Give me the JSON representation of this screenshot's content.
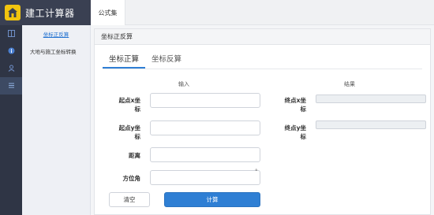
{
  "app": {
    "title": "建工计算器",
    "logo_icon": "house-icon"
  },
  "topbar": {
    "tab_label": "公式集"
  },
  "rail": {
    "icons": [
      "grid-icon",
      "info-icon",
      "user-icon",
      "list-icon"
    ],
    "active_index": 3
  },
  "menu": {
    "items": [
      {
        "label": "坐标正反算",
        "active": true
      },
      {
        "label": "大地与施工坐标转换",
        "active": false
      }
    ]
  },
  "panel": {
    "title": "坐标正反算",
    "tabs": [
      {
        "label": "坐标正算",
        "active": true
      },
      {
        "label": "坐标反算",
        "active": false
      }
    ],
    "input_title": "输入",
    "result_title": "结果",
    "inputs": {
      "start_x": {
        "label_line1": "起点x坐",
        "label_line2": "标",
        "value": ""
      },
      "start_y": {
        "label_line1": "起点y坐",
        "label_line2": "标",
        "value": ""
      },
      "distance": {
        "label": "距离",
        "value": ""
      },
      "azimuth": {
        "label": "方位角",
        "value": "",
        "unit": "°"
      }
    },
    "results": {
      "end_x": {
        "label_line1": "终点x坐",
        "label_line2": "标",
        "value": ""
      },
      "end_y": {
        "label_line1": "终点y坐",
        "label_line2": "标",
        "value": ""
      }
    },
    "buttons": {
      "clear": "清空",
      "calculate": "计算"
    }
  },
  "colors": {
    "sidebar_dark": "#2f3545",
    "accent": "#2f7fd4",
    "logo": "#f1c40f"
  }
}
